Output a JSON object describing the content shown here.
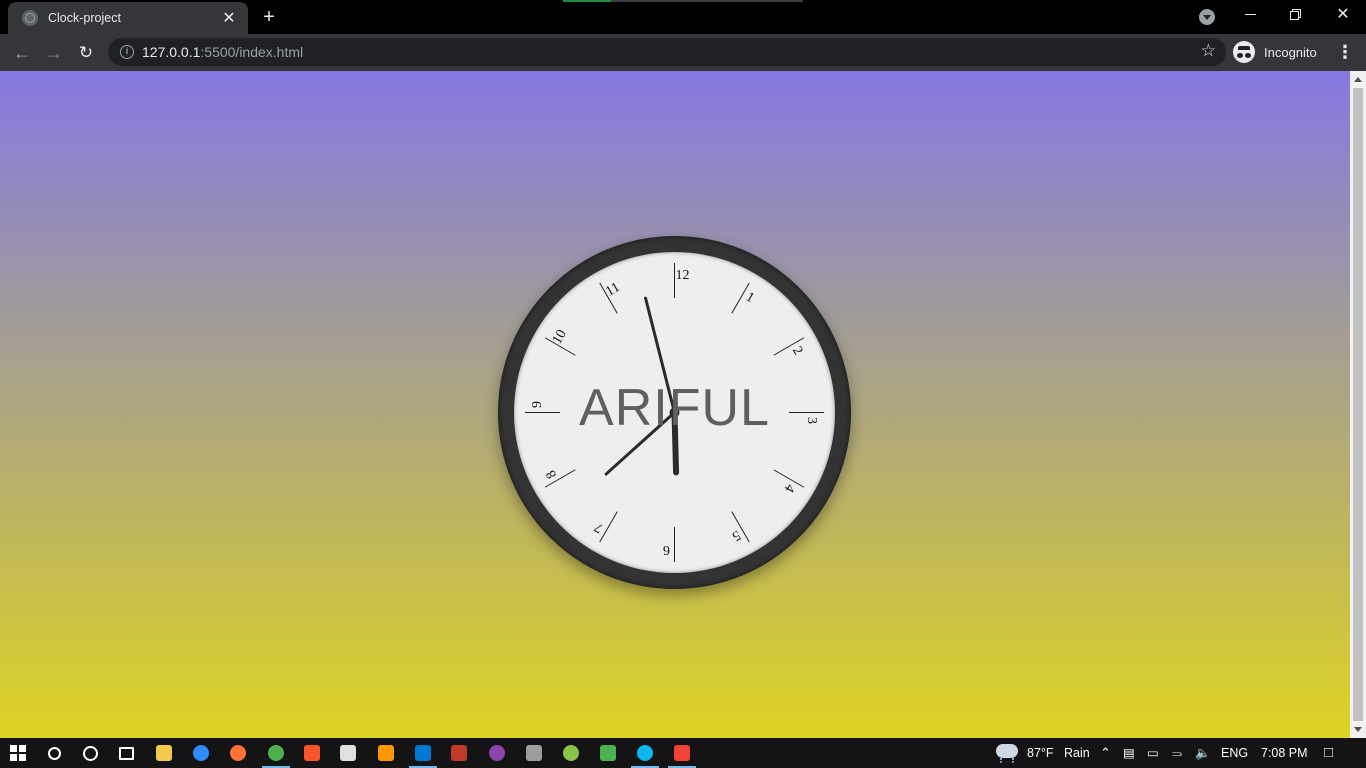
{
  "browser": {
    "tab_title": "Clock-project",
    "new_tab": "+",
    "url_host": "127.0.0.1",
    "url_rest": ":5500/index.html",
    "profile_label": "Incognito",
    "close_glyph": "✕"
  },
  "clock": {
    "name": "ARIFUL",
    "numbers": [
      "12",
      "1",
      "2",
      "3",
      "4",
      "5",
      "6",
      "7",
      "8",
      "9",
      "10",
      "11"
    ],
    "time_shown": {
      "hours": 5,
      "minutes": 57,
      "seconds": 38
    },
    "colors": {
      "bezel": "#333333",
      "face": "#eeeeee",
      "hand": "#2b2b2b",
      "text": "#5f5f5f"
    }
  },
  "page": {
    "gradient": [
      "#8678e2",
      "#a29c98",
      "#c1b75a",
      "#ddd424"
    ]
  },
  "taskbar": {
    "icons": [
      "windows-start-icon",
      "search-icon",
      "cortana-icon",
      "task-view-icon",
      "file-explorer-icon",
      "zoom-icon",
      "firefox-icon",
      "chrome-icon",
      "brave-icon",
      "notepad-icon",
      "sublime-text-icon",
      "vscode-icon",
      "winrar-icon",
      "github-desktop-icon",
      "obs-icon",
      "notepad-plus-icon",
      "minecraft-icon",
      "edge-icon",
      "git-icon"
    ],
    "weather_temp": "87°F",
    "weather_desc": "Rain",
    "language": "ENG",
    "time": "7:08 PM"
  }
}
